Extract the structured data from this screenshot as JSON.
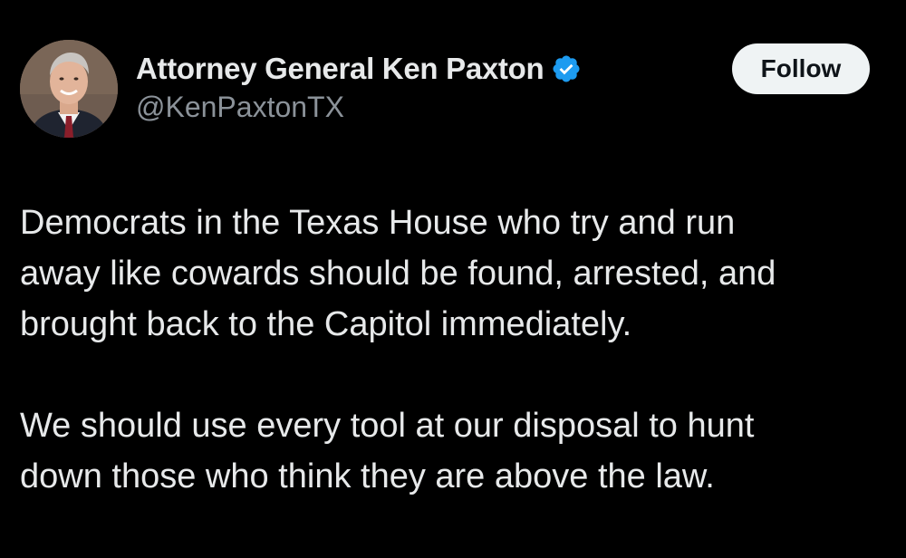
{
  "author": {
    "display_name": "Attorney General Ken Paxton",
    "handle": "@KenPaxtonTX",
    "verified_icon": "verified-badge-icon",
    "verified_color": "#1d9bf0"
  },
  "follow_button": {
    "label": "Follow"
  },
  "tweet": {
    "paragraphs": [
      "Democrats in the Texas House who try and run\naway like cowards should be found, arrested, and\nbrought back to the Capitol immediately.",
      "We should use every tool at our disposal to hunt\ndown those who think they are above the law."
    ]
  },
  "colors": {
    "background": "#000000",
    "text_primary": "#e7e9ea",
    "text_secondary": "#8b9299",
    "button_bg": "#eff3f4",
    "button_text": "#0f1419"
  }
}
